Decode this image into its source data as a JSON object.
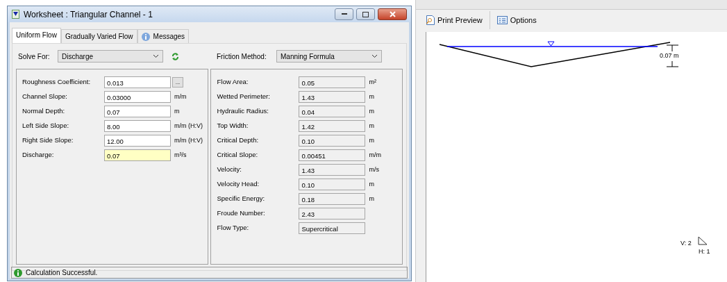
{
  "window": {
    "title": "Worksheet : Triangular Channel - 1"
  },
  "tabs": [
    {
      "label": "Uniform Flow",
      "selected": true,
      "kind": "plain"
    },
    {
      "label": "Gradually Varied Flow",
      "selected": false,
      "kind": "plain"
    },
    {
      "label": "Messages",
      "selected": false,
      "kind": "info"
    }
  ],
  "solve_for": {
    "label": "Solve For:",
    "value": "Discharge"
  },
  "friction_method": {
    "label": "Friction Method:",
    "value": "Manning Formula"
  },
  "inputs": [
    {
      "label": "Roughness Coefficient:",
      "value": "0.013",
      "button": "...",
      "solved": false
    },
    {
      "label": "Channel Slope:",
      "value": "0.03000",
      "unit": "m/m",
      "solved": false
    },
    {
      "label": "Normal Depth:",
      "value": "0.07",
      "unit": "m",
      "solved": false
    },
    {
      "label": "Left Side Slope:",
      "value": "8.00",
      "unit": "m/m (H:V)",
      "solved": false
    },
    {
      "label": "Right Side Slope:",
      "value": "12.00",
      "unit": "m/m (H:V)",
      "solved": false
    },
    {
      "label": "Discharge:",
      "value": "0.07",
      "unit": "m³/s",
      "solved": true
    }
  ],
  "results": [
    {
      "label": "Flow Area:",
      "value": "0.05",
      "unit": "m²"
    },
    {
      "label": "Wetted Perimeter:",
      "value": "1.43",
      "unit": "m"
    },
    {
      "label": "Hydraulic Radius:",
      "value": "0.04",
      "unit": "m"
    },
    {
      "label": "Top Width:",
      "value": "1.42",
      "unit": "m"
    },
    {
      "label": "Critical Depth:",
      "value": "0.10",
      "unit": "m"
    },
    {
      "label": "Critical Slope:",
      "value": "0.00451",
      "unit": "m/m"
    },
    {
      "label": "Velocity:",
      "value": "1.43",
      "unit": "m/s"
    },
    {
      "label": "Velocity Head:",
      "value": "0.10",
      "unit": "m"
    },
    {
      "label": "Specific Energy:",
      "value": "0.18",
      "unit": "m"
    },
    {
      "label": "Froude Number:",
      "value": "2.43"
    },
    {
      "label": "Flow Type:",
      "value": "Supercritical"
    }
  ],
  "status_bar": {
    "text": "Calculation Successful."
  },
  "preview": {
    "toolbar": [
      {
        "label": "Print Preview",
        "kind": "print"
      },
      {
        "label": "Options",
        "kind": "options"
      }
    ],
    "depth_label": "0.07 m",
    "scale_v": "V: 2",
    "scale_h": "H: 1"
  }
}
